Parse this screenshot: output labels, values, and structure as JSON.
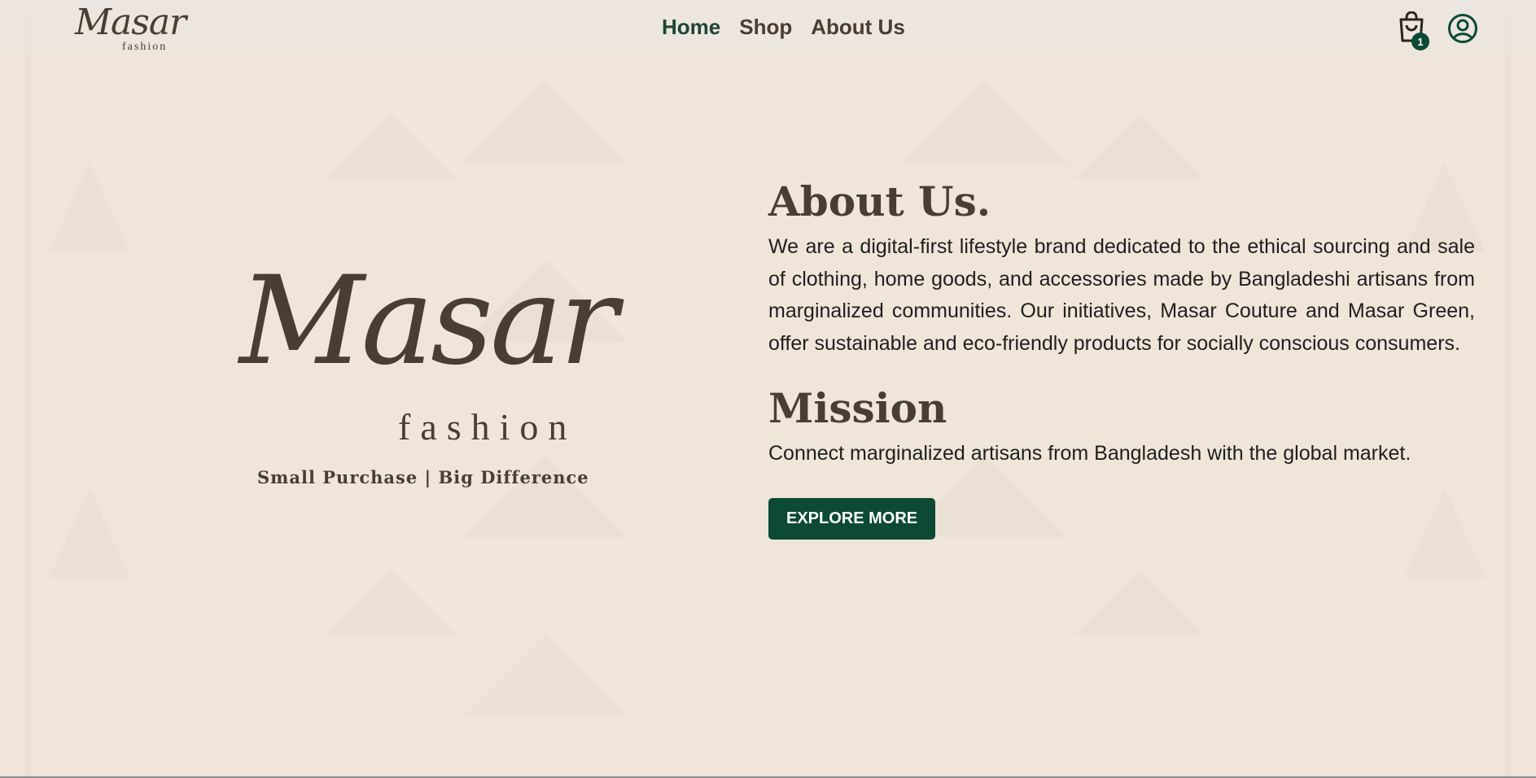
{
  "header": {
    "logo_script": "Masar",
    "logo_sub": "fashion",
    "nav": {
      "home": "Home",
      "shop": "Shop",
      "about": "About Us"
    },
    "cart_count": "1",
    "icons": {
      "cart": "shopping-bag-icon",
      "account": "user-circle-icon"
    }
  },
  "brand": {
    "script": "Masar",
    "sub": "fashion",
    "tagline": "Small Purchase | Big Difference"
  },
  "about": {
    "title": "About Us.",
    "body": "We are a digital-first lifestyle brand dedicated to the ethical sourcing and sale of clothing, home goods, and accessories made by Bangladeshi artisans from marginalized communities. Our initiatives, Masar Couture and Masar Green, offer sustainable and eco-friendly products for socially conscious consumers."
  },
  "mission": {
    "title": "Mission",
    "body": "Connect marginalized artisans from Bangladesh with the global market."
  },
  "cta": {
    "label": "EXPLORE MORE"
  },
  "colors": {
    "background": "#efe5d8",
    "brown": "#4a3d33",
    "green": "#0c4a35"
  }
}
